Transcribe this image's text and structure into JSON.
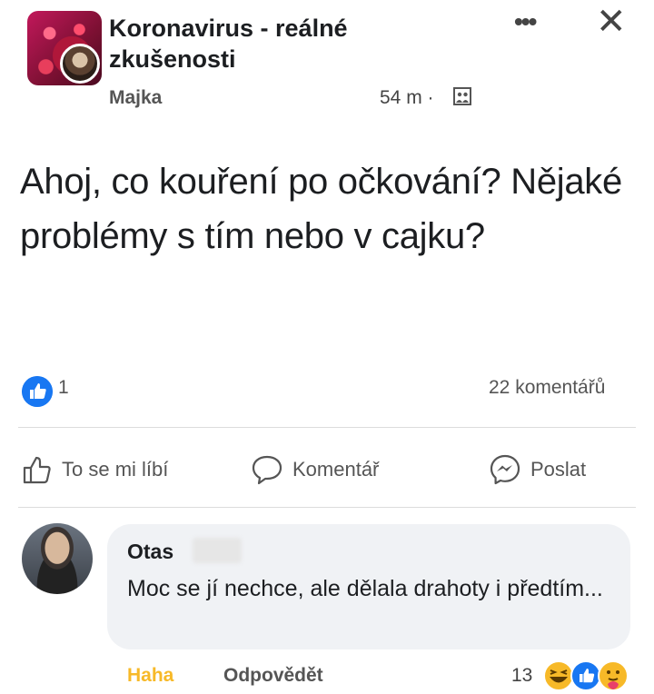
{
  "post": {
    "group_title": "Koronavirus - reálné zkušenosti",
    "author": "Majka",
    "time": "54 m ·",
    "text": "Ahoj, co kouření po očkování? Nějaké problémy s tím nebo v cajku?",
    "reactions_count": "1",
    "comments_count": "22 komentářů"
  },
  "actions": {
    "like": "To se mi líbí",
    "comment": "Komentář",
    "share": "Poslat"
  },
  "comment": {
    "author": "Otas",
    "text": "Moc se jí nechce, ale dělala drahoty i předtím...",
    "haha": "Haha",
    "reply": "Odpovědět",
    "reactions_count": "13"
  },
  "colors": {
    "facebook_blue": "#1877f2",
    "haha_yellow": "#f7b928",
    "bubble_bg": "#f0f2f5"
  },
  "icons": [
    "group-avatar",
    "privacy-icon",
    "more-icon",
    "close-icon",
    "like-icon",
    "comment-icon",
    "messenger-icon",
    "haha-reaction-icon",
    "like-reaction-icon",
    "care-reaction-icon"
  ]
}
